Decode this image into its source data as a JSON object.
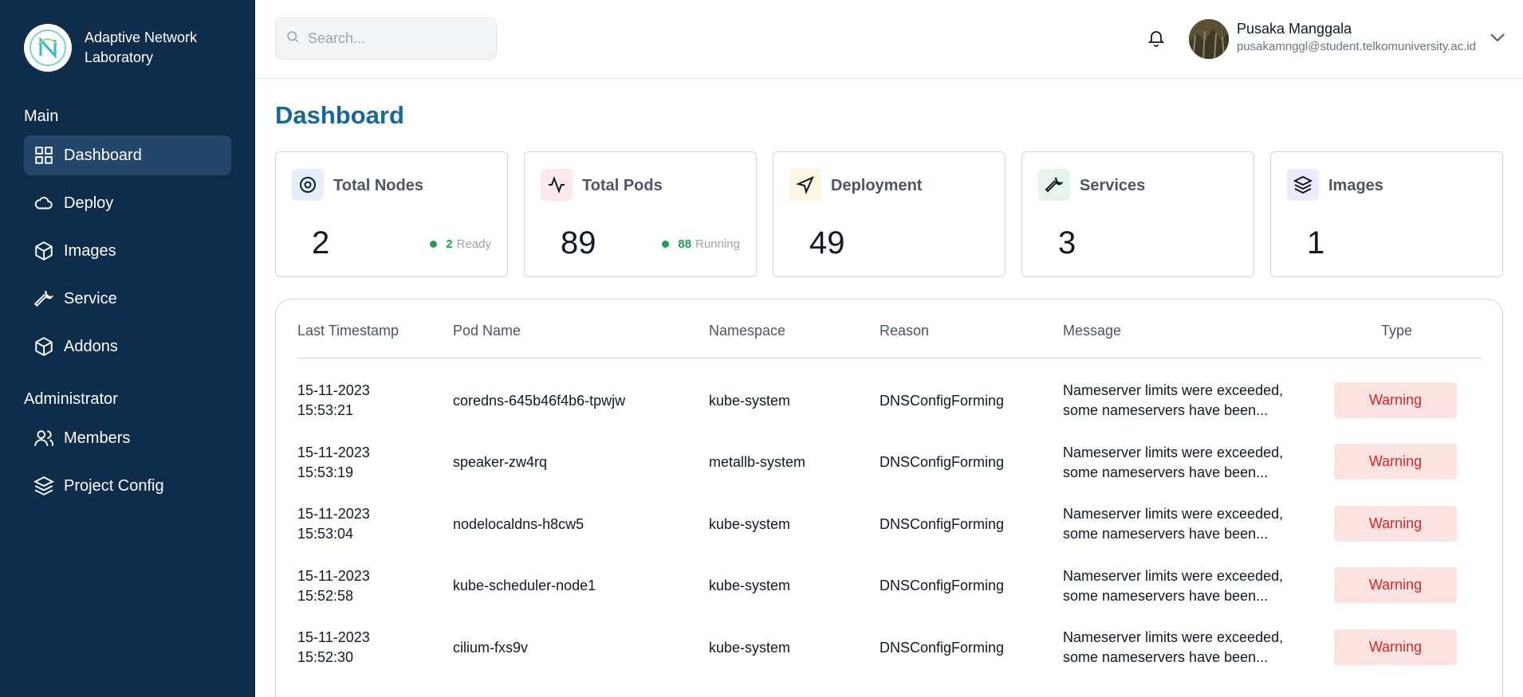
{
  "brand": {
    "name": "Adaptive Network Laboratory"
  },
  "sidebar": {
    "sections": [
      {
        "label": "Main"
      },
      {
        "label": "Administrator"
      }
    ],
    "items": [
      {
        "label": "Dashboard",
        "icon": "grid-icon",
        "active": true
      },
      {
        "label": "Deploy",
        "icon": "cloud-icon"
      },
      {
        "label": "Images",
        "icon": "box-icon"
      },
      {
        "label": "Service",
        "icon": "wrench-icon"
      },
      {
        "label": "Addons",
        "icon": "box-icon"
      },
      {
        "label": "Members",
        "icon": "users-icon"
      },
      {
        "label": "Project Config",
        "icon": "layers-icon"
      }
    ]
  },
  "header": {
    "search_placeholder": "Search...",
    "user": {
      "name": "Pusaka Manggala",
      "email": "pusakamnggl@student.telkomuniversity.ac.id"
    }
  },
  "page": {
    "title": "Dashboard"
  },
  "cards": [
    {
      "label": "Total Nodes",
      "value": "2",
      "status_count": "2",
      "status_text": "Ready",
      "icon": "target-icon",
      "icon_bg": "#e7eefb"
    },
    {
      "label": "Total Pods",
      "value": "89",
      "status_count": "88",
      "status_text": "Running",
      "icon": "activity-icon",
      "icon_bg": "#fde8ec"
    },
    {
      "label": "Deployment",
      "value": "49",
      "icon": "send-icon",
      "icon_bg": "#fdf6e3"
    },
    {
      "label": "Services",
      "value": "3",
      "icon": "wrench-icon",
      "icon_bg": "#e6f4ea"
    },
    {
      "label": "Images",
      "value": "1",
      "icon": "layers-icon",
      "icon_bg": "#efeafb"
    }
  ],
  "table": {
    "headers": [
      "Last Timestamp",
      "Pod Name",
      "Namespace",
      "Reason",
      "Message",
      "Type"
    ],
    "rows": [
      {
        "date": "15-11-2023",
        "time": "15:53:21",
        "pod": "coredns-645b46f4b6-tpwjw",
        "namespace": "kube-system",
        "reason": "DNSConfigForming",
        "msg1": "Nameserver limits were exceeded,",
        "msg2": "some nameservers have been...",
        "type": "Warning"
      },
      {
        "date": "15-11-2023",
        "time": "15:53:19",
        "pod": "speaker-zw4rq",
        "namespace": "metallb-system",
        "reason": "DNSConfigForming",
        "msg1": "Nameserver limits were exceeded,",
        "msg2": "some nameservers have been...",
        "type": "Warning"
      },
      {
        "date": "15-11-2023",
        "time": "15:53:04",
        "pod": "nodelocaldns-h8cw5",
        "namespace": "kube-system",
        "reason": "DNSConfigForming",
        "msg1": "Nameserver limits were exceeded,",
        "msg2": "some nameservers have been...",
        "type": "Warning"
      },
      {
        "date": "15-11-2023",
        "time": "15:52:58",
        "pod": "kube-scheduler-node1",
        "namespace": "kube-system",
        "reason": "DNSConfigForming",
        "msg1": "Nameserver limits were exceeded,",
        "msg2": "some nameservers have been...",
        "type": "Warning"
      },
      {
        "date": "15-11-2023",
        "time": "15:52:30",
        "pod": "cilium-fxs9v",
        "namespace": "kube-system",
        "reason": "DNSConfigForming",
        "msg1": "Nameserver limits were exceeded,",
        "msg2": "some nameservers have been...",
        "type": "Warning"
      }
    ]
  },
  "colors": {
    "sidebar_bg": "#0d2d4b",
    "title": "#15679e",
    "warning_bg": "#fde2e2",
    "warning_text": "#dc2626",
    "ready_dot": "#22a04b"
  }
}
